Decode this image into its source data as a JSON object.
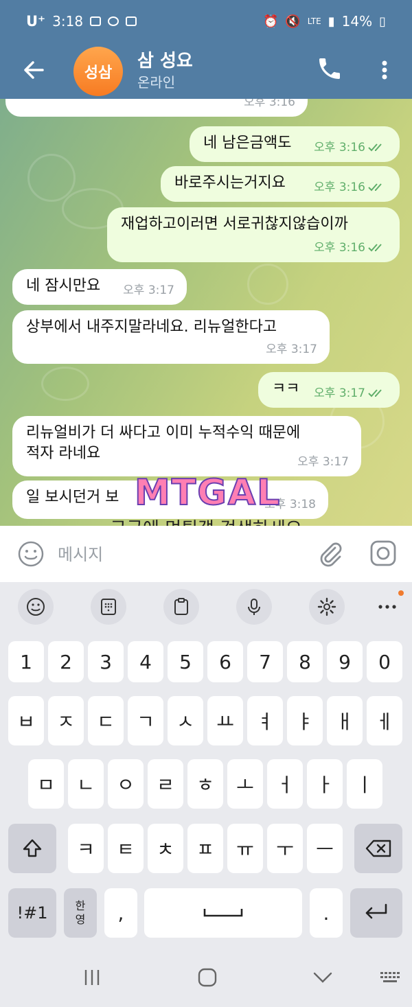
{
  "status_bar": {
    "carrier": "U⁺",
    "time": "3:18",
    "network": "LTE",
    "battery": "14%"
  },
  "header": {
    "avatar_initials": "성삼",
    "contact_name": "삼 성요",
    "contact_status": "온라인"
  },
  "messages": [
    {
      "dir": "in",
      "text": "",
      "time": "오후 3:16"
    },
    {
      "dir": "out",
      "text": "네 남은금액도",
      "time": "오후 3:16",
      "read": true
    },
    {
      "dir": "out",
      "text": "바로주시는거지요",
      "time": "오후 3:16",
      "read": true
    },
    {
      "dir": "out",
      "text": "재업하고이러면 서로귀찮지않습이까",
      "time": "오후 3:16",
      "read": true
    },
    {
      "dir": "in",
      "text": "네 잠시만요",
      "time": "오후 3:17"
    },
    {
      "dir": "in",
      "text": "상부에서 내주지말라네요. 리뉴얼한다고",
      "time": "오후 3:17"
    },
    {
      "dir": "out",
      "text": "ㅋㅋ",
      "time": "오후 3:17",
      "read": true
    },
    {
      "dir": "in",
      "text": "리뉴얼비가 더 싸다고 이미 누적수익 때문에",
      "text2": "적자 라네요",
      "time": "오후 3:17"
    },
    {
      "dir": "in",
      "text": "일 보시던거 보",
      "time": "오후 3:18"
    }
  ],
  "watermark": {
    "logo_text": "MTGAL",
    "caption": "구글에 먹튀갤 검색하세요"
  },
  "input": {
    "placeholder": "메시지",
    "value": ""
  },
  "keyboard": {
    "row_numbers": [
      "1",
      "2",
      "3",
      "4",
      "5",
      "6",
      "7",
      "8",
      "9",
      "0"
    ],
    "row1": [
      "ㅂ",
      "ㅈ",
      "ㄷ",
      "ㄱ",
      "ㅅ",
      "ㅛ",
      "ㅕ",
      "ㅑ",
      "ㅐ",
      "ㅔ"
    ],
    "row2": [
      "ㅁ",
      "ㄴ",
      "ㅇ",
      "ㄹ",
      "ㅎ",
      "ㅗ",
      "ㅓ",
      "ㅏ",
      "ㅣ"
    ],
    "row3": [
      "ㅋ",
      "ㅌ",
      "ㅊ",
      "ㅍ",
      "ㅠ",
      "ㅜ",
      "ㅡ"
    ],
    "symbols_label": "!#1",
    "lang_label_top": "한",
    "lang_label_bottom": "영",
    "comma": ",",
    "period": "."
  },
  "colors": {
    "header_bg": "#527da3",
    "bubble_out": "#effdde",
    "bubble_in": "#ffffff",
    "read_tick": "#5fae6a",
    "avatar": "#f7892e"
  }
}
